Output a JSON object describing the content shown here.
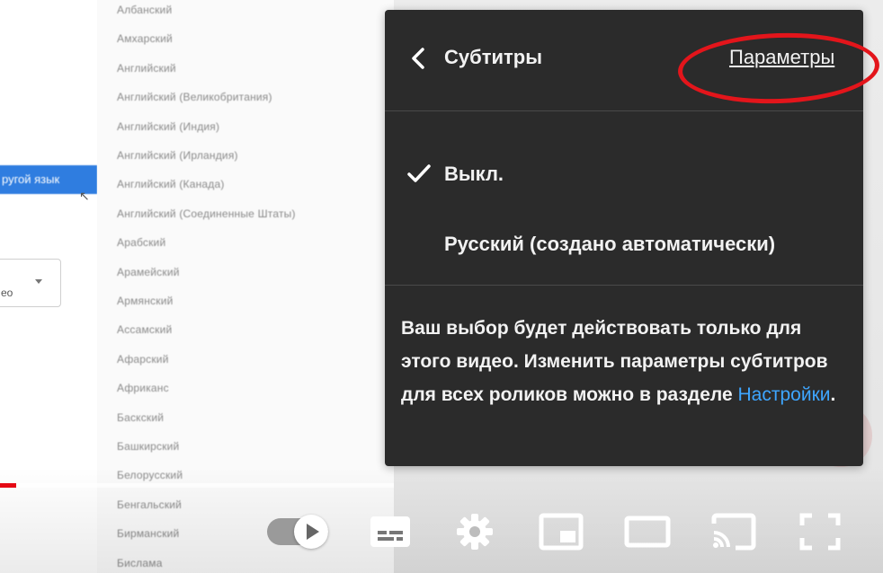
{
  "background": {
    "other_language_button": "ругой язык",
    "dropdown_text": "ео",
    "languages": [
      "Албанский",
      "Амхарский",
      "Английский",
      "Английский (Великобритания)",
      "Английский (Индия)",
      "Английский (Ирландия)",
      "Английский (Канада)",
      "Английский (Соединенные Штаты)",
      "Арабский",
      "Арамейский",
      "Армянский",
      "Ассамский",
      "Афарский",
      "Африканс",
      "Баскский",
      "Башкирский",
      "Белорусский",
      "Бенгальский",
      "Бирманский",
      "Бислама"
    ]
  },
  "captions_menu": {
    "title": "Субтитры",
    "options_link": "Параметры",
    "options": [
      {
        "label": "Выкл.",
        "selected": true
      },
      {
        "label": "Русский (создано автоматически)",
        "selected": false
      }
    ],
    "note": "Ваш выбор будет действовать только для этого видео. Изменить параметры субтитров для всех роликов можно в разделе ",
    "note_link": "Настройки",
    "note_end": "."
  },
  "player": {
    "progress": 0.04,
    "progress_color": "#e50914",
    "controls": [
      "autoplay-toggle",
      "subtitles-icon",
      "gear-icon",
      "miniplayer-icon",
      "theater-mode-icon",
      "cast-icon",
      "fullscreen-icon"
    ]
  },
  "colors": {
    "panel_bg": "#2b2b2b",
    "link": "#3ea6ff",
    "highlight": "#e3151b"
  }
}
